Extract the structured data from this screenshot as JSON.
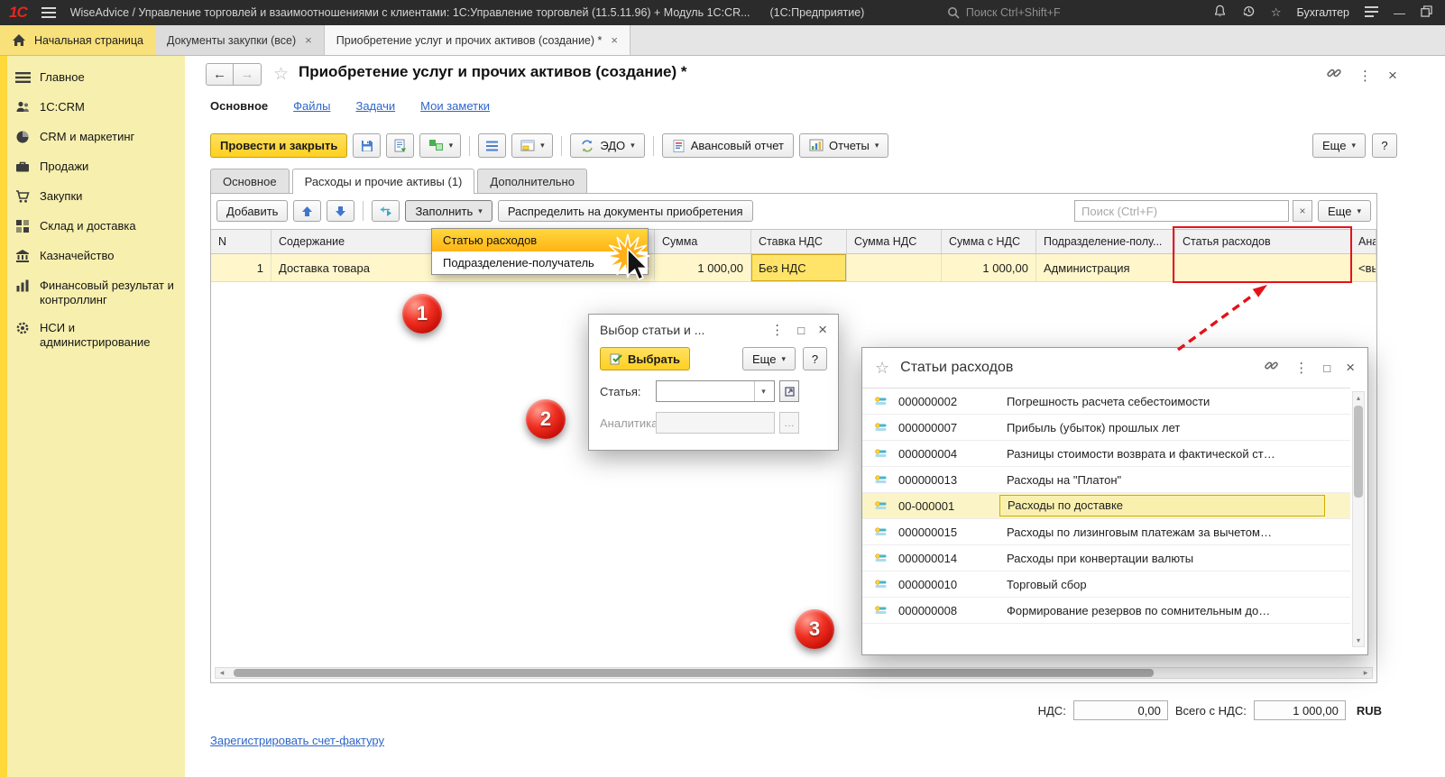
{
  "colors": {
    "accent_yellow": "#ffd633",
    "annotation_red": "#e8101c",
    "link_blue": "#2e66c9",
    "selected_row": "#fff7cb"
  },
  "glyphs": {
    "close": "×",
    "caret": "▾",
    "kebab": "⋮",
    "maximize": "□",
    "star": "☆",
    "back": "←",
    "forward": "→",
    "minimize": "—",
    "scroll_left": "◂",
    "scroll_right": "▸",
    "scroll_up": "▴",
    "scroll_down": "▾",
    "dots": "…"
  },
  "titlebar": {
    "logo": "1С",
    "app_title": "WiseAdvice / Управление торговлей и взаимоотношениями с клиентами: 1С:Управление торговлей (11.5.11.96) + Модуль 1С:CR...",
    "app_suffix": "(1С:Предприятие)",
    "search_placeholder": "Поиск Ctrl+Shift+F",
    "user": "Бухгалтер"
  },
  "tabbar": {
    "home": "Начальная страница",
    "tabs": [
      {
        "label": "Документы закупки (все)"
      },
      {
        "label": "Приобретение услуг и прочих активов (создание) *"
      }
    ]
  },
  "sidebar": {
    "items": [
      {
        "label": "Главное"
      },
      {
        "label": "1С:CRM"
      },
      {
        "label": "CRM и маркетинг"
      },
      {
        "label": "Продажи"
      },
      {
        "label": "Закупки"
      },
      {
        "label": "Склад и доставка"
      },
      {
        "label": "Казначейство"
      },
      {
        "label": "Финансовый результат и контроллинг"
      },
      {
        "label": "НСИ и администрирование"
      }
    ]
  },
  "doc": {
    "title": "Приобретение услуг и прочих активов (создание) *",
    "links": [
      "Основное",
      "Файлы",
      "Задачи",
      "Мои заметки"
    ],
    "toolbar": {
      "post_close": "Провести и закрыть",
      "edo": "ЭДО",
      "advance": "Авансовый отчет",
      "reports": "Отчеты",
      "more": "Еще",
      "help": "?"
    },
    "tabs": [
      "Основное",
      "Расходы и прочие активы (1)",
      "Дополнительно"
    ],
    "grid_toolbar": {
      "add": "Добавить",
      "fill": "Заполнить",
      "distribute": "Распределить на документы приобретения",
      "search_placeholder": "Поиск (Ctrl+F)",
      "more": "Еще"
    },
    "fill_menu": {
      "items": [
        "Статью расходов",
        "Подразделение-получатель"
      ]
    },
    "grid": {
      "columns": [
        "N",
        "Содержание",
        "Сумма",
        "Ставка НДС",
        "Сумма НДС",
        "Сумма с НДС",
        "Подразделение-полу...",
        "Статья расходов",
        "Анал"
      ],
      "row": {
        "n": "1",
        "content": "Доставка товара",
        "sum": "1 000,00",
        "vat_rate": "Без НДС",
        "vat_sum": "",
        "total": "1 000,00",
        "department": "Администрация",
        "expense_item": "",
        "analytics": "<выб"
      }
    },
    "totals": {
      "vat_label": "НДС:",
      "vat_value": "0,00",
      "total_label": "Всего с НДС:",
      "total_value": "1 000,00",
      "currency": "RUB"
    },
    "register_link": "Зарегистрировать счет-фактуру"
  },
  "pick_dialog": {
    "title": "Выбор статьи и ...",
    "select": "Выбрать",
    "more": "Еще",
    "help": "?",
    "field1_label": "Статья:",
    "field2_label": "Аналитика:"
  },
  "expense_window": {
    "title": "Статьи расходов",
    "rows": [
      {
        "code": "000000002",
        "name": "Погрешность расчета себестоимости"
      },
      {
        "code": "000000007",
        "name": "Прибыль (убыток) прошлых лет"
      },
      {
        "code": "000000004",
        "name": "Разницы стоимости возврата и фактической ст…"
      },
      {
        "code": "000000013",
        "name": "Расходы на \"Платон\""
      },
      {
        "code": "00-000001",
        "name": "Расходы по доставке"
      },
      {
        "code": "000000015",
        "name": "Расходы по лизинговым платежам за вычетом…"
      },
      {
        "code": "000000014",
        "name": "Расходы при конвертации валюты"
      },
      {
        "code": "000000010",
        "name": "Торговый сбор"
      },
      {
        "code": "000000008",
        "name": "Формирование резервов по сомнительным до…"
      }
    ]
  },
  "annotations": {
    "step1": "1",
    "step2": "2",
    "step3": "3"
  }
}
